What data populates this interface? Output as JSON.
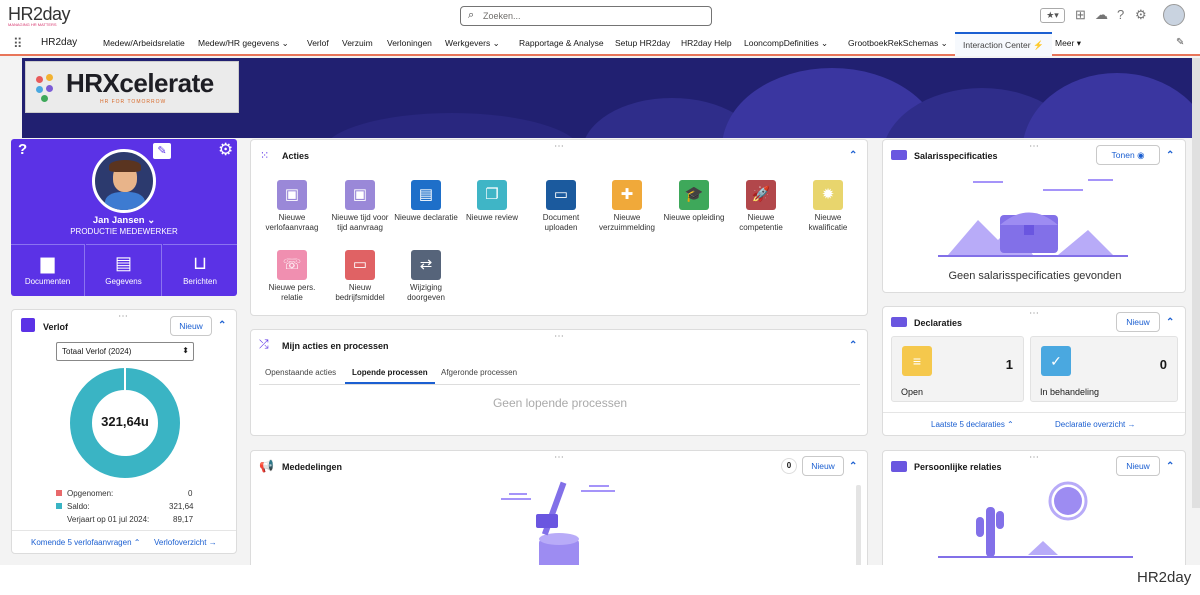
{
  "header": {
    "logo": "HR2day",
    "logo_sub": "MANAGING HR MATTERS",
    "search_placeholder": "Zoeken..."
  },
  "nav": {
    "app_name": "HR2day",
    "items": [
      "Medew/Arbeidsrelatie",
      "Medew/HR gegevens",
      "Verlof",
      "Verzuim",
      "Verloningen",
      "Werkgevers",
      "Rapportage & Analyse",
      "Setup HR2day",
      "HR2day Help",
      "LooncompDefinities",
      "GrootboekRekSchemas",
      "Interaction Center",
      "Meer"
    ]
  },
  "banner": {
    "brand": "HRXcelerate",
    "tagline": "HR FOR TOMORROW"
  },
  "profile": {
    "name": "Jan Jansen",
    "role": "PRODUCTIE MEDEWERKER",
    "buttons": [
      "Documenten",
      "Gegevens",
      "Berichten"
    ]
  },
  "verlof": {
    "title": "Verlof",
    "new_label": "Nieuw",
    "select_value": "Totaal Verlof (2024)",
    "donut_value": "321,64u",
    "legend": [
      {
        "label": "Opgenomen:",
        "value": "0",
        "color": "#e8696b"
      },
      {
        "label": "Saldo:",
        "value": "321,64",
        "color": "#3ab4c4"
      }
    ],
    "expire_label": "Verjaart op 01 jul 2024:",
    "expire_value": "89,17",
    "link_upcoming": "Komende 5 verlofaanvragen",
    "link_overview": "Verlofoverzicht",
    "used_fraction": 0.0
  },
  "acties": {
    "title": "Acties",
    "items": [
      {
        "label": "Nieuwe verlofaanvraag",
        "color": "#9a88d8",
        "icon": "briefcase-icon"
      },
      {
        "label": "Nieuwe tijd voor tijd aanvraag",
        "color": "#9a88d8",
        "icon": "briefcase-icon"
      },
      {
        "label": "Nieuwe declaratie",
        "color": "#1e6fc9",
        "icon": "form-icon"
      },
      {
        "label": "Nieuwe review",
        "color": "#3fb5c6",
        "icon": "copy-icon"
      },
      {
        "label": "Document uploaden",
        "color": "#1b5a9e",
        "icon": "folder-icon"
      },
      {
        "label": "Nieuwe verzuimmelding",
        "color": "#f0a93a",
        "icon": "medkit-icon"
      },
      {
        "label": "Nieuwe opleiding",
        "color": "#3ea85a",
        "icon": "graduation-icon"
      },
      {
        "label": "Nieuwe competentie",
        "color": "#b2474b",
        "icon": "rocket-icon"
      },
      {
        "label": "Nieuwe kwalificatie",
        "color": "#e8d56d",
        "icon": "badge-icon"
      },
      {
        "label": "Nieuwe pers. relatie",
        "color": "#f08fb0",
        "icon": "phone-icon"
      },
      {
        "label": "Nieuw bedrijfsmiddel",
        "color": "#e06264",
        "icon": "laptop-icon"
      },
      {
        "label": "Wijziging doorgeven",
        "color": "#56647a",
        "icon": "swap-icon"
      }
    ]
  },
  "processen": {
    "title": "Mijn acties en processen",
    "tabs": [
      "Openstaande acties",
      "Lopende processen",
      "Afgeronde processen"
    ],
    "active_tab": 1,
    "empty": "Geen lopende processen"
  },
  "mededelingen": {
    "title": "Mededelingen",
    "count": "0",
    "new_label": "Nieuw"
  },
  "salaris": {
    "title": "Salarisspecificaties",
    "show_label": "Tonen",
    "empty": "Geen salarisspecificaties gevonden"
  },
  "declaraties": {
    "title": "Declaraties",
    "new_label": "Nieuw",
    "tiles": [
      {
        "label": "Open",
        "count": "1",
        "color": "#f5c84c"
      },
      {
        "label": "In behandeling",
        "count": "0",
        "color": "#4aa8e0"
      }
    ],
    "link_last": "Laatste 5 declaraties",
    "link_overview": "Declaratie overzicht"
  },
  "relaties": {
    "title": "Persoonlijke relaties",
    "new_label": "Nieuw"
  },
  "footer": {
    "logo": "HR2day"
  },
  "colors": {
    "accent": "#1b5fd1",
    "purple": "#5b32e6",
    "banner": "#212071",
    "donut": "#3ab4c4"
  }
}
